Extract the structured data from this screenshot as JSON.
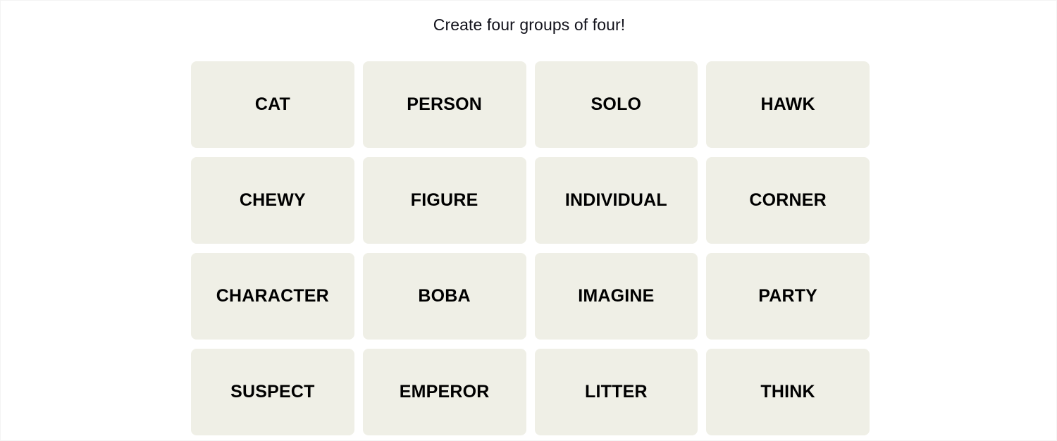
{
  "page": {
    "background_color": "#ffffff",
    "border_color": "#f4f4f4"
  },
  "header": {
    "title": "Create four groups of four!",
    "title_color": "#12121b"
  },
  "board": {
    "rows": 4,
    "columns": 4,
    "tile_background": "#efefe6",
    "tile_text_color": "#000000",
    "tiles": [
      {
        "label": "CAT"
      },
      {
        "label": "PERSON"
      },
      {
        "label": "SOLO"
      },
      {
        "label": "HAWK"
      },
      {
        "label": "CHEWY"
      },
      {
        "label": "FIGURE"
      },
      {
        "label": "INDIVIDUAL"
      },
      {
        "label": "CORNER"
      },
      {
        "label": "CHARACTER"
      },
      {
        "label": "BOBA"
      },
      {
        "label": "IMAGINE"
      },
      {
        "label": "PARTY"
      },
      {
        "label": "SUSPECT"
      },
      {
        "label": "EMPEROR"
      },
      {
        "label": "LITTER"
      },
      {
        "label": "THINK"
      }
    ]
  }
}
